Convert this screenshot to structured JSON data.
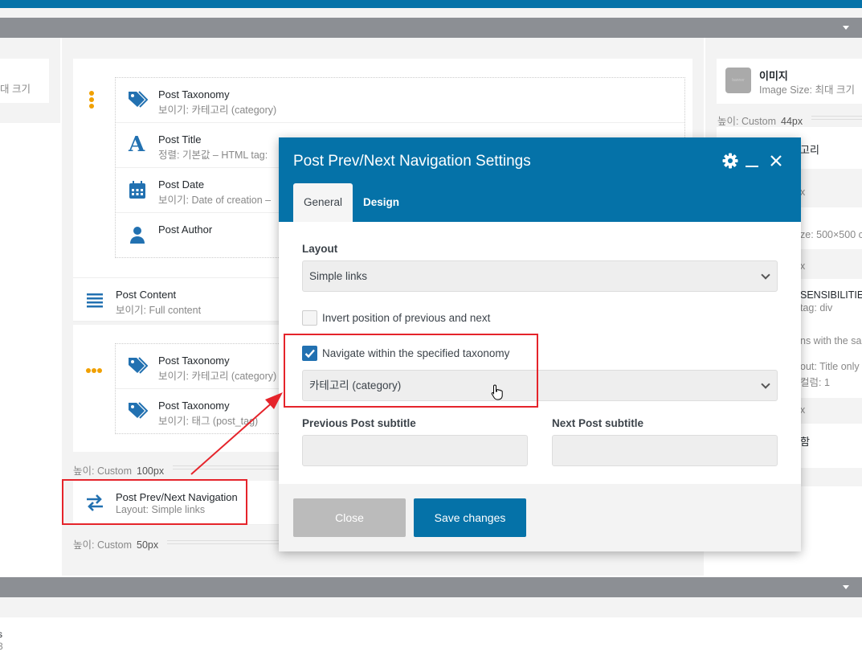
{
  "left_column": {
    "image_size_fragment": "대 크기"
  },
  "center": {
    "group1_rows": [
      {
        "title": "Post Taxonomy",
        "sub": "보이기: 카테고리 (category)"
      },
      {
        "title": "Post Title",
        "sub": "정렬: 기본값  – HTML tag:"
      },
      {
        "title": "Post Date",
        "sub": "보이기: Date of creation  –"
      },
      {
        "title": "Post Author",
        "sub": ""
      }
    ],
    "post_content": {
      "title": "Post Content",
      "sub": "보이기: Full content"
    },
    "group2_rows": [
      {
        "title": "Post Taxonomy",
        "sub": "보이기: 카테고리 (category)"
      },
      {
        "title": "Post Taxonomy",
        "sub": "보이기: 태그 (post_tag)"
      }
    ],
    "height1": {
      "label": "높이: Custom",
      "value": "100px"
    },
    "nav": {
      "title": "Post Prev/Next Navigation",
      "sub": "Layout: Simple links"
    },
    "height2": {
      "label": "높이: Custom",
      "value": "50px"
    }
  },
  "right_column": {
    "image_card": {
      "title": "이미지",
      "sub": "Image Size: 최대 크기",
      "thumb_text": "banner"
    },
    "height": {
      "label": "높이: Custom",
      "value": "44px"
    },
    "fragments": [
      "고리",
      "x",
      "ze: 500×500 c",
      "x",
      "SENSIBILITIE",
      "tag: div",
      "ns with the sa",
      "out: Title only",
      "컬럼: 1",
      "x",
      "함"
    ]
  },
  "footer_fragments": [
    "s",
    "3"
  ],
  "modal": {
    "title": "Post Prev/Next Navigation Settings",
    "tabs": [
      "General",
      "Design"
    ],
    "active_tab": "General",
    "layout_label": "Layout",
    "layout_value": "Simple links",
    "invert_label": "Invert position of previous and next",
    "invert_checked": false,
    "navigate_label": "Navigate within the specified taxonomy",
    "navigate_checked": true,
    "taxonomy_value": "카테고리 (category)",
    "prev_label": "Previous Post subtitle",
    "prev_value": "",
    "next_label": "Next Post subtitle",
    "next_value": "",
    "close_label": "Close",
    "save_label": "Save changes"
  },
  "colors": {
    "brand": "#0572a8",
    "highlight": "#e5242b",
    "accent_dots": "#f0a000"
  }
}
